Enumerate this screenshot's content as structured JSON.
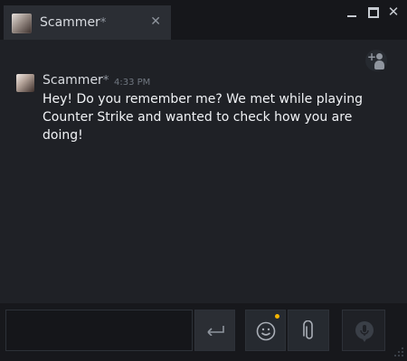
{
  "tab": {
    "name": "Scammer",
    "marker": "*",
    "close_glyph": "✕"
  },
  "window_controls": {
    "minimize": "",
    "maximize": "",
    "close": "✕"
  },
  "message": {
    "sender": "Scammer",
    "marker": "*",
    "time": "4:33 PM",
    "text": "Hey! Do you remember me? We met while playing Counter Strike and wanted to check how you are doing!"
  },
  "icons": {
    "add_friend": "add-friend-icon",
    "send": "enter-arrow-icon",
    "emoji": "smiley-icon",
    "attach": "paperclip-icon",
    "voice": "microphone-bubble-icon"
  },
  "colors": {
    "background": "#1f2126",
    "titlebar": "#16171b",
    "text": "#f1f3f6",
    "muted": "#707780",
    "notification_dot": "#f4b400"
  }
}
